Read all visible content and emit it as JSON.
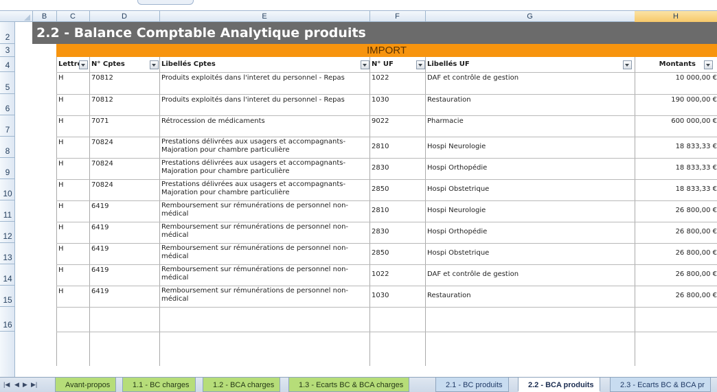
{
  "columns": [
    "B",
    "C",
    "D",
    "E",
    "F",
    "G",
    "H"
  ],
  "rows": [
    "2",
    "3",
    "4",
    "5",
    "6",
    "7",
    "8",
    "9",
    "10",
    "11",
    "12",
    "13",
    "14",
    "15",
    "16"
  ],
  "title": "2.2 - Balance Comptable Analytique produits",
  "section": "IMPORT",
  "headers": {
    "lettre": "Lettre",
    "cptes": "N° Cptes",
    "libelles_cptes": "Libellés Cptes",
    "uf": "N° UF",
    "libelles_uf": "Libellés UF",
    "montants": "Montants"
  },
  "data_rows": [
    {
      "lettre": "H",
      "compte": "70812",
      "libelle": "Produits exploités dans l'interet du personnel - Repas",
      "uf": "1022",
      "libelle_uf": "DAF et contrôle de gestion",
      "montant": "10 000,00 €"
    },
    {
      "lettre": "H",
      "compte": "70812",
      "libelle": "Produits exploités dans l'interet du personnel - Repas",
      "uf": "1030",
      "libelle_uf": "Restauration",
      "montant": "190 000,00 €"
    },
    {
      "lettre": "H",
      "compte": "7071",
      "libelle": "Rétrocession de médicaments",
      "uf": "9022",
      "libelle_uf": "Pharmacie",
      "montant": "600 000,00 €"
    },
    {
      "lettre": "H",
      "compte": "70824",
      "libelle": "Prestations délivrées aux usagers et accompagnants-Majoration pour chambre particulière",
      "uf": "2810",
      "libelle_uf": "Hospi Neurologie",
      "montant": "18 833,33 €"
    },
    {
      "lettre": "H",
      "compte": "70824",
      "libelle": "Prestations délivrées aux usagers et accompagnants-Majoration pour chambre particulière",
      "uf": "2830",
      "libelle_uf": "Hospi Orthopédie",
      "montant": "18 833,33 €"
    },
    {
      "lettre": "H",
      "compte": "70824",
      "libelle": "Prestations délivrées aux usagers et accompagnants-Majoration pour chambre particulière",
      "uf": "2850",
      "libelle_uf": "Hospi Obstetrique",
      "montant": "18 833,33 €"
    },
    {
      "lettre": "H",
      "compte": "6419",
      "libelle": "Remboursement sur rémunérations de personnel non-médical",
      "uf": "2810",
      "libelle_uf": "Hospi Neurologie",
      "montant": "26 800,00 €"
    },
    {
      "lettre": "H",
      "compte": "6419",
      "libelle": "Remboursement sur rémunérations de personnel non-médical",
      "uf": "2830",
      "libelle_uf": "Hospi Orthopédie",
      "montant": "26 800,00 €"
    },
    {
      "lettre": "H",
      "compte": "6419",
      "libelle": "Remboursement sur rémunérations de personnel non-médical",
      "uf": "2850",
      "libelle_uf": "Hospi Obstetrique",
      "montant": "26 800,00 €"
    },
    {
      "lettre": "H",
      "compte": "6419",
      "libelle": "Remboursement sur rémunérations de personnel non-médical",
      "uf": "1022",
      "libelle_uf": "DAF et contrôle de gestion",
      "montant": "26 800,00 €"
    },
    {
      "lettre": "H",
      "compte": "6419",
      "libelle": "Remboursement sur rémunérations de personnel non-médical",
      "uf": "1030",
      "libelle_uf": "Restauration",
      "montant": "26 800,00 €"
    }
  ],
  "tabs": [
    {
      "label": "Avant-propos",
      "style": "green"
    },
    {
      "label": "1.1 - BC charges",
      "style": "green"
    },
    {
      "label": "1.2 - BCA charges",
      "style": "green"
    },
    {
      "label": "1.3 - Ecarts BC & BCA charges",
      "style": "green"
    },
    {
      "label": "2.1 - BC produits",
      "style": "blue"
    },
    {
      "label": "2.2 - BCA produits",
      "style": "active"
    },
    {
      "label": "2.3 - Ecarts BC & BCA pr",
      "style": "blue"
    }
  ],
  "colors": {
    "title_bg": "#6b6b6b",
    "import_bg": "#f7940e",
    "selected_col": "#f7c96a"
  }
}
